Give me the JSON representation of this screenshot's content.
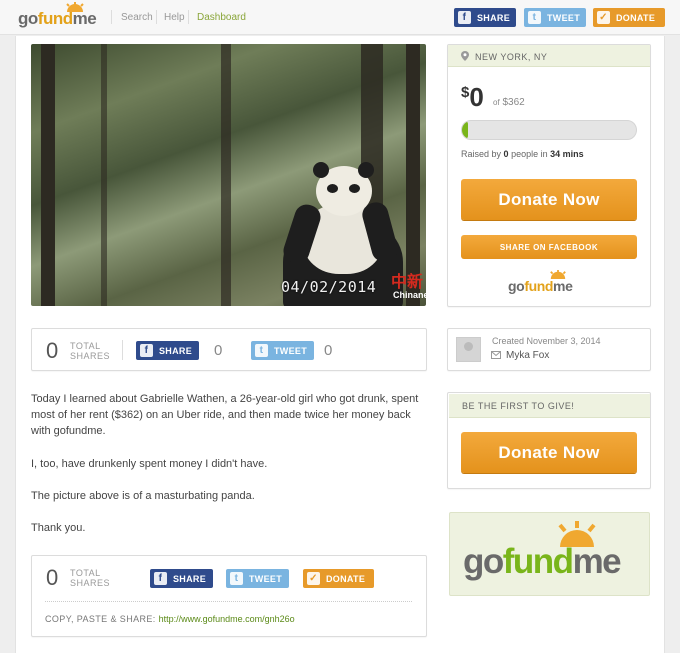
{
  "header": {
    "logo_part1": "go",
    "logo_part2": "fund",
    "logo_part3": "me",
    "nav": [
      "Search",
      "Help",
      "Dashboard"
    ],
    "share_label": "SHARE",
    "tweet_label": "TWEET",
    "donate_label": "DONATE"
  },
  "photo": {
    "date_stamp": "04/02/2014",
    "watermark_cn": "中新",
    "watermark_en": "Chinanews"
  },
  "campaign": {
    "location": "NEW YORK, NY",
    "currency": "$",
    "raised_amount": "0",
    "goal_prefix": "of",
    "goal_amount": "$362",
    "progress_fraction": 0.03,
    "raised_by_prefix": "Raised by",
    "people_count": "0",
    "people_mid": "people in",
    "duration": "34 mins",
    "donate_now_label": "Donate Now",
    "share_facebook_label": "SHARE ON FACEBOOK"
  },
  "share_top": {
    "total_count": "0",
    "total_label_1": "TOTAL",
    "total_label_2": "SHARES",
    "fb_label": "SHARE",
    "fb_count": "0",
    "tw_label": "TWEET",
    "tw_count": "0"
  },
  "organizer": {
    "created_text": "Created November 3, 2014",
    "name": "Myka Fox"
  },
  "first_give": {
    "heading": "BE THE FIRST TO GIVE!",
    "donate_label": "Donate Now"
  },
  "story": {
    "paragraphs": [
      "Today I learned about Gabrielle Wathen, a 26-year-old girl who got drunk, spent most of her rent ($362) on an Uber ride, and then made twice her money back with gofundme.",
      "I, too, have drunkenly spent money I didn't have.",
      "The picture above is of a masturbating panda.",
      "Thank you."
    ]
  },
  "share_bottom": {
    "total_count": "0",
    "total_label_1": "TOTAL",
    "total_label_2": "SHARES",
    "fb_label": "SHARE",
    "tw_label": "TWEET",
    "donate_label": "DONATE",
    "copy_label": "COPY, PASTE & SHARE:",
    "url": "http://www.gofundme.com/gnh26o"
  },
  "colors": {
    "brand_orange": "#e79a2a",
    "brand_green": "#79b51a",
    "facebook_blue": "#2f4b8c",
    "twitter_blue": "#7ab4e0"
  },
  "icons": {
    "facebook": "facebook-icon",
    "twitter": "twitter-icon",
    "check": "check-icon",
    "pin": "map-pin-icon",
    "mail": "mail-icon"
  }
}
